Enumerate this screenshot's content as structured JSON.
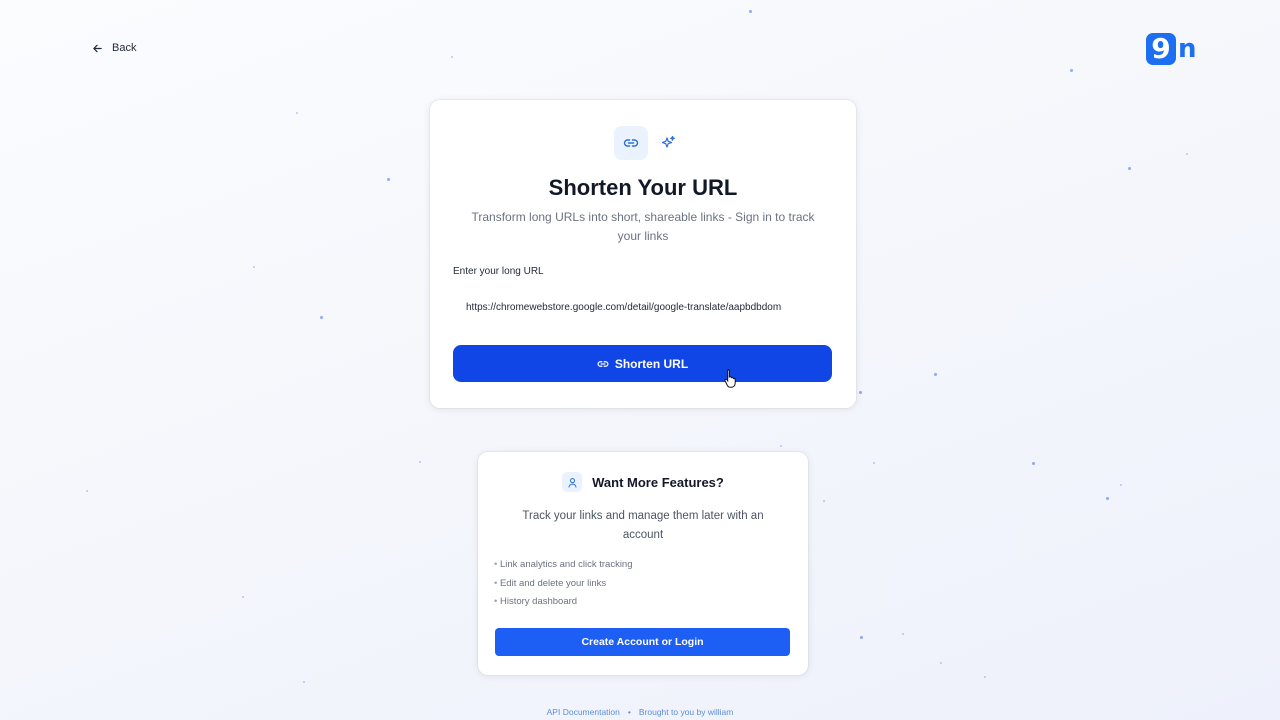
{
  "nav": {
    "back_label": "Back"
  },
  "logo": {
    "mark": "9",
    "suffix": "n",
    "brand_color": "#1d6ff2"
  },
  "shortener": {
    "title": "Shorten Your URL",
    "subtitle": "Transform long URLs into short, shareable links - Sign in to track your links",
    "input_label": "Enter your long URL",
    "input_value": "https://chromewebstore.google.com/detail/google-translate/aapbdbdom",
    "button_label": "Shorten URL",
    "button_color": "#1146e6",
    "icons": [
      "link-icon",
      "sparkle-icon"
    ]
  },
  "features": {
    "title": "Want More Features?",
    "subtitle": "Track your links and manage them later with an account",
    "items": [
      "Link analytics and click tracking",
      "Edit and delete your links",
      "History dashboard"
    ],
    "button_label": "Create Account or Login",
    "button_color": "#1d5ef5"
  },
  "footer": {
    "api_docs": "API Documentation",
    "separator": "•",
    "credit": "Brought to you by william"
  }
}
